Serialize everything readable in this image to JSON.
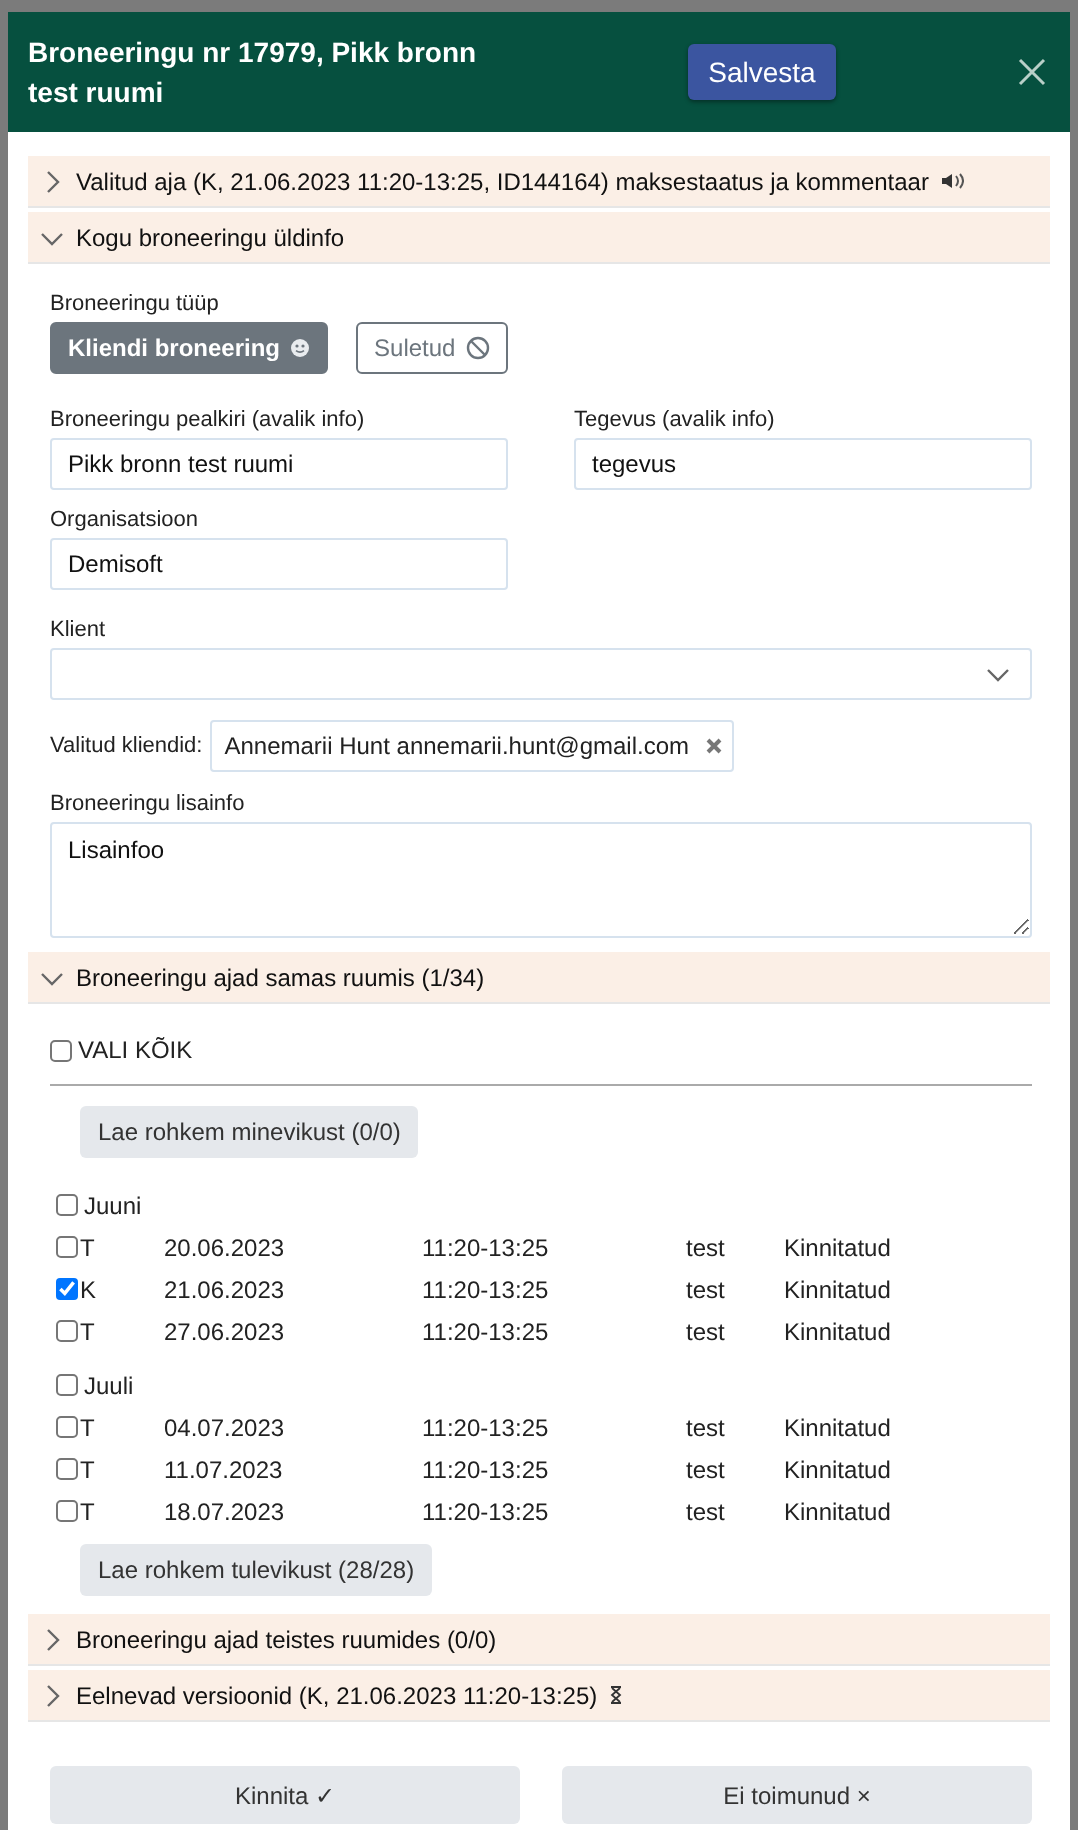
{
  "dialog": {
    "title": "Broneeringu nr 17979, Pikk bronn test ruumi",
    "save_button": "Salvesta"
  },
  "sections": [
    {
      "title": "Valitud aja (K, 21.06.2023 11:20-13:25, ID144164) maksestaatus ja kommentaar",
      "expanded": false,
      "kind": "payment"
    },
    {
      "title": "Kogu broneeringu üldinfo",
      "expanded": true,
      "kind": "general"
    },
    {
      "title": "Broneeringu ajad samas ruumis (1/34)",
      "expanded": true,
      "kind": "times"
    },
    {
      "title": "Broneeringu ajad teistes ruumides (0/0)",
      "expanded": false,
      "kind": "other"
    },
    {
      "title": "Eelnevad versioonid (K, 21.06.2023 11:20-13:25)",
      "expanded": false,
      "kind": "versions"
    }
  ],
  "general_info": {
    "type_label": "Broneeringu tüüp",
    "type_options": [
      {
        "label": "Kliendi broneering",
        "selected": true,
        "kind": "client"
      },
      {
        "label": "Suletud",
        "selected": false,
        "kind": "closed"
      }
    ],
    "title_field": {
      "label": "Broneeringu pealkiri (avalik info)",
      "value": "Pikk bronn test ruumi"
    },
    "activity_field": {
      "label": "Tegevus (avalik info)",
      "value": "tegevus"
    },
    "organization_field": {
      "label": "Organisatsioon",
      "value": "Demisoft"
    },
    "client_field": {
      "label": "Klient"
    },
    "selected_clients": {
      "label": "Valitud kliendid:",
      "chips": [
        "Annemarii Hunt annemarii.hunt@gmail.com"
      ]
    },
    "notes_field": {
      "label": "Broneeringu lisainfo",
      "value": "Lisainfoo"
    }
  },
  "same_room_times": {
    "select_all": {
      "label": "VALI KÕIK",
      "checked": false
    },
    "load_past": "Lae rohkem minevikust (0/0)",
    "groups": [
      {
        "month": "Juuni",
        "checked": false,
        "rows": [
          {
            "day": "T",
            "date": "20.06.2023",
            "time": "11:20-13:25",
            "activity": "test",
            "status": "Kinnitatud",
            "checked": false
          },
          {
            "day": "K",
            "date": "21.06.2023",
            "time": "11:20-13:25",
            "activity": "test",
            "status": "Kinnitatud",
            "checked": true
          },
          {
            "day": "T",
            "date": "27.06.2023",
            "time": "11:20-13:25",
            "activity": "test",
            "status": "Kinnitatud",
            "checked": false
          }
        ]
      },
      {
        "month": "Juuli",
        "checked": false,
        "rows": [
          {
            "day": "T",
            "date": "04.07.2023",
            "time": "11:20-13:25",
            "activity": "test",
            "status": "Kinnitatud",
            "checked": false
          },
          {
            "day": "T",
            "date": "11.07.2023",
            "time": "11:20-13:25",
            "activity": "test",
            "status": "Kinnitatud",
            "checked": false
          },
          {
            "day": "T",
            "date": "18.07.2023",
            "time": "11:20-13:25",
            "activity": "test",
            "status": "Kinnitatud",
            "checked": false
          }
        ]
      }
    ],
    "load_future": "Lae rohkem tulevikust (28/28)"
  },
  "footer_buttons": [
    "Kinnita ✓",
    "Ei toimunud ×"
  ]
}
